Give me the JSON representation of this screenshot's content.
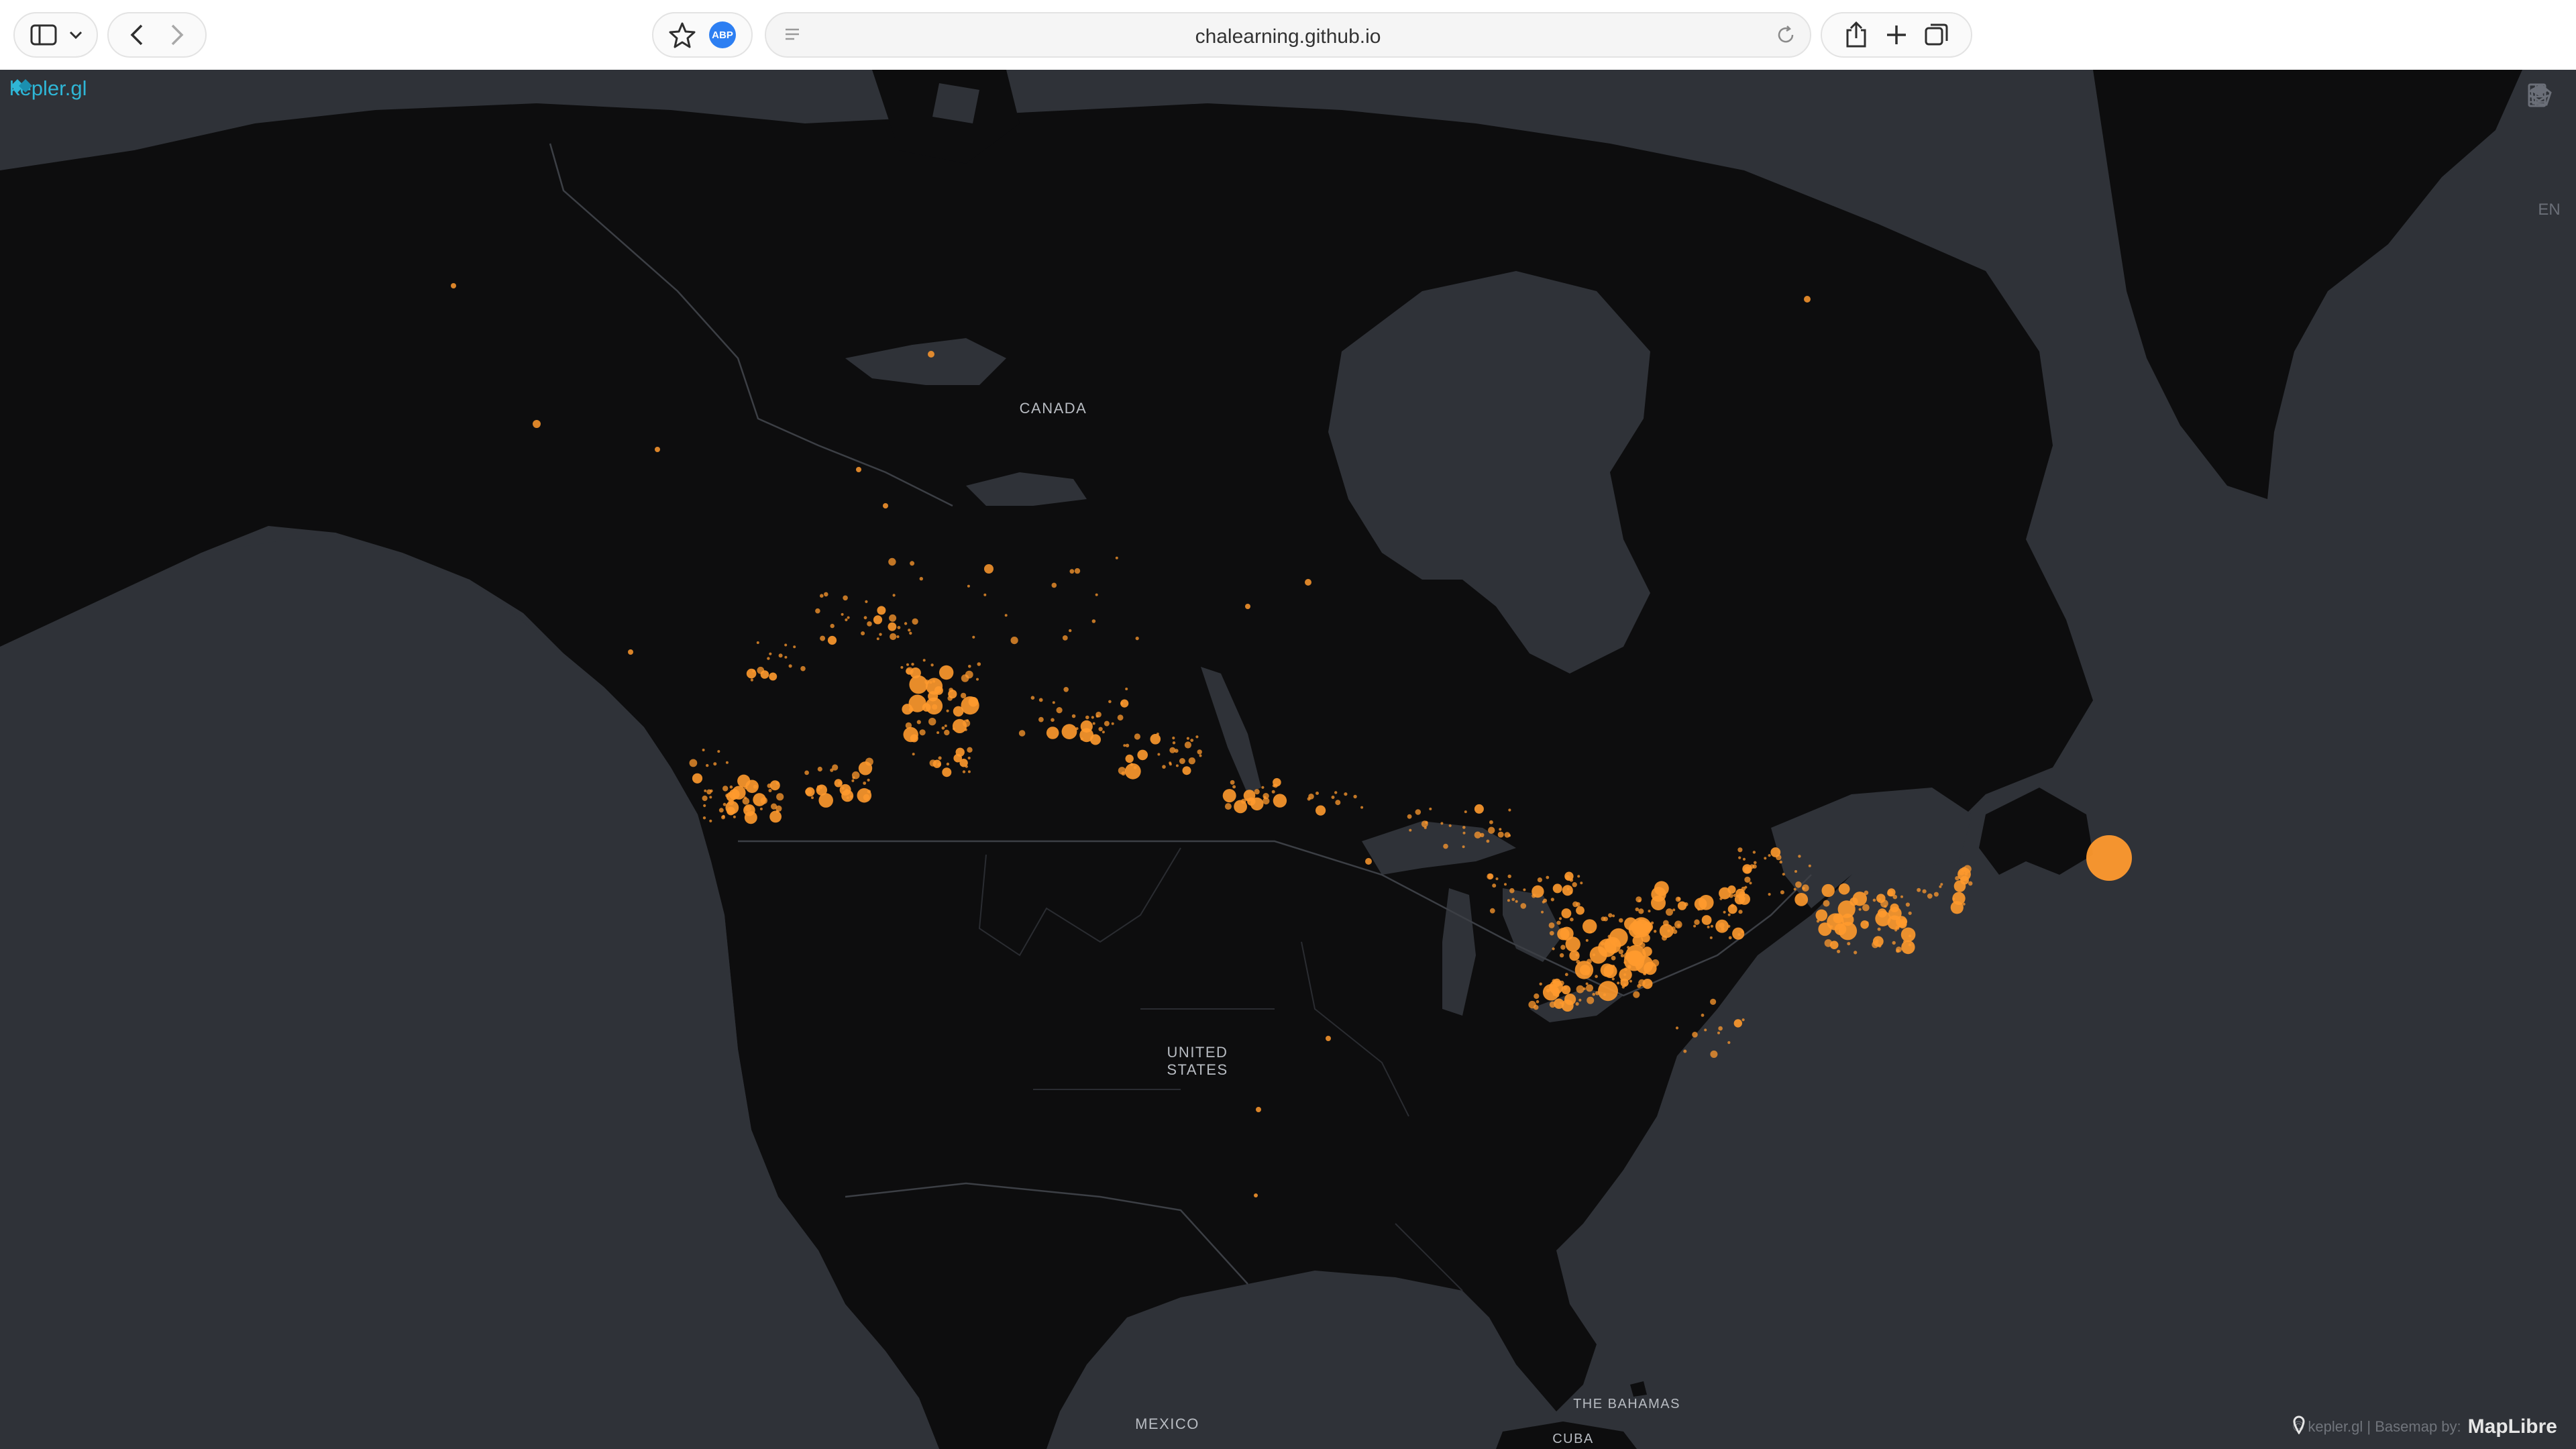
{
  "browser": {
    "url": "chalearning.github.io",
    "abp_label": "ABP"
  },
  "app": {
    "name": "kepler.gl",
    "lang": "EN"
  },
  "map_labels": {
    "canada": "CANADA",
    "united_states": "UNITED\nSTATES",
    "mexico": "MEXICO",
    "bahamas": "THE BAHAMAS",
    "cuba": "CUBA"
  },
  "attribution": {
    "credit": "© kepler.gl | Basemap by:",
    "basemap": "MapLibre"
  },
  "colors": {
    "land": "#0d0d0e",
    "water": "#2f3238",
    "point": "#ff9a2e",
    "accent": "#2fb6d6"
  }
}
